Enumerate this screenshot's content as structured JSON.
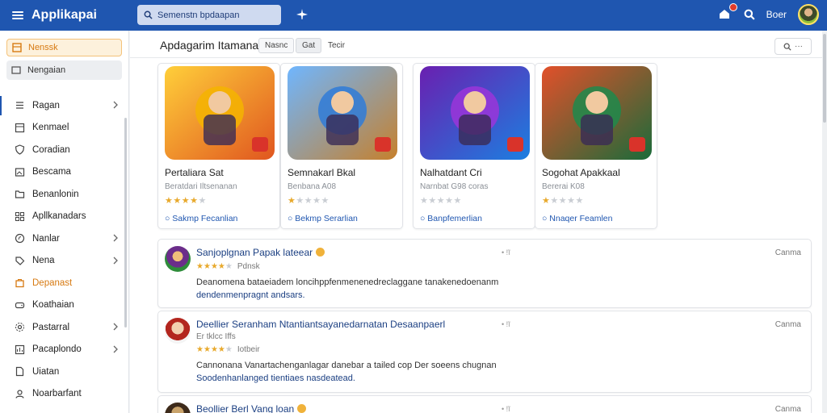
{
  "app": {
    "title": "Applikapai"
  },
  "search": {
    "placeholder": "Semenstn bpdaapan"
  },
  "header": {
    "user_label": "Boer"
  },
  "sidebar": {
    "pinned": [
      {
        "label": "Nenssk"
      },
      {
        "label": "Nengaian"
      }
    ],
    "items": [
      {
        "label": "Ragan",
        "icon": "list-icon",
        "chevron": true
      },
      {
        "label": "Kenmael",
        "icon": "grid-icon",
        "chevron": false
      },
      {
        "label": "Coradian",
        "icon": "shield-icon",
        "chevron": false
      },
      {
        "label": "Bescama",
        "icon": "image-icon",
        "chevron": false
      },
      {
        "label": "Benanlonin",
        "icon": "folder-icon",
        "chevron": false
      },
      {
        "label": "Apllkanadars",
        "icon": "apps-icon",
        "chevron": false
      },
      {
        "label": "Nanlar",
        "icon": "compass-icon",
        "chevron": true
      },
      {
        "label": "Nena",
        "icon": "tag-icon",
        "chevron": true
      },
      {
        "label": "Depanast",
        "icon": "bag-icon",
        "chevron": false
      },
      {
        "label": "Koathaian",
        "icon": "gamepad-icon",
        "chevron": false
      },
      {
        "label": "Pastarral",
        "icon": "settings-icon",
        "chevron": true
      },
      {
        "label": "Pacaplondo",
        "icon": "chart-icon",
        "chevron": true
      },
      {
        "label": "Uiatan",
        "icon": "doc-icon",
        "chevron": false
      },
      {
        "label": "Noarbarfant",
        "icon": "user-icon",
        "chevron": false
      }
    ]
  },
  "main": {
    "page_title": "Apdagarim Itamanai",
    "chips": [
      "Nasnc",
      "Gat",
      "Tecir"
    ],
    "sort_label": "Q ···",
    "cards": [
      {
        "name": "Pertaliara Sat",
        "subtitle": "Beratdari Iltsenanan",
        "rating": 4,
        "cta": "Sakmp Fecanlian",
        "accent": "#f5b400"
      },
      {
        "name": "Semnakarl Bkal",
        "subtitle": "Benbana A08",
        "rating": 1,
        "cta": "Bekmp Serarlian",
        "accent": "#2f7bd8"
      },
      {
        "name": "Nalhatdant Cri",
        "subtitle": "Narnbat G98 coras",
        "rating": 0,
        "cta": "Banpfemerlian",
        "accent": "#9b35d9"
      },
      {
        "name": "Sogohat Apakkaal",
        "subtitle": "Bererai K08",
        "rating": 1,
        "cta": "Nnaqer Feamlen",
        "accent": "#1f8a4c"
      }
    ],
    "reviews": [
      {
        "title": "Sanjoplgnan Papak lateear",
        "dots": "• !ĩ",
        "right": "Canma",
        "meta": "★★★★☆ Pdnsk",
        "rating": 4,
        "meta_text": "Pdnsk",
        "body_1": "Deanomena bataeiadem loncihppfenmenenedreclaggane tanakenedoenanm",
        "body_2": "dendenmenpragnt andsars."
      },
      {
        "title": "Deellier Seranham Ntantiantsayanedarnatan Desaanpaerl",
        "dots": "• !ĩ",
        "right": "Canma",
        "meta_top": "Er tklcc Iffs",
        "rating": 4,
        "meta_text": "Iotbeir",
        "body_1": "Cannonana Vanartachenganlagar danebar a tailed cop Der soeens chugnan",
        "body_2": "Soodenhanlanged tientiaes nasdeatead."
      },
      {
        "title": "Beollier Berl Vang loan",
        "dots": "• !ĩ",
        "right": "Canma"
      }
    ]
  },
  "colors": {
    "topbar": "#1f56b0",
    "accent_orange": "#d77a12",
    "link": "#1b3f82"
  }
}
